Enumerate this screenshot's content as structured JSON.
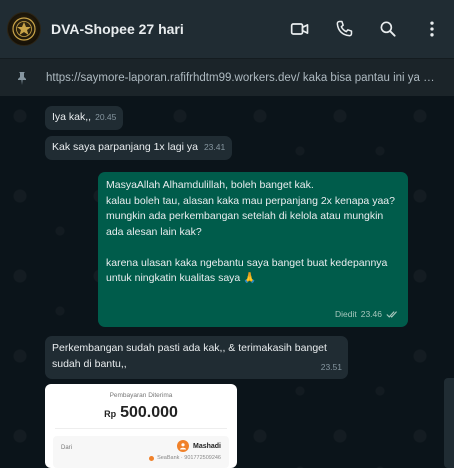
{
  "header": {
    "title": "DVA-Shopee 27 hari",
    "avatar_icon": "gold-emblem-icon",
    "actions": [
      "video-call-icon",
      "voice-call-icon",
      "search-icon",
      "more-options-icon"
    ]
  },
  "pinned": {
    "icon": "pin-icon",
    "text": "https://saymore-laporan.rafifrhdtm99.workers.dev/ kaka bisa pantau ini ya u..."
  },
  "messages": [
    {
      "direction": "incoming",
      "text": "Iya kak,,",
      "time": "20.45"
    },
    {
      "direction": "incoming",
      "text": "Kak saya parpanjang 1x lagi ya",
      "time": "23.41"
    },
    {
      "direction": "outgoing",
      "text": "MasyaAllah Alhamdulillah, boleh banget kak.\nkalau boleh tau, alasan kaka mau perpanjang 2x kenapa yaa?\nmungkin ada perkembangan setelah di kelola atau mungkin ada alesan lain kak?\n\nkarena ulasan kaka ngebantu saya banget buat kedepannya untuk ningkatin kualitas saya 🙏",
      "edited_label": "Diedit",
      "time": "23.46",
      "status": "read"
    },
    {
      "direction": "incoming",
      "text": "Perkembangan sudah pasti ada kak,, & terimakasih banget sudah di bantu,,",
      "time": "23.51"
    }
  ],
  "receipt": {
    "caption": "Pembayaran Diterima",
    "currency": "Rp",
    "amount": "500.000",
    "from_label": "Dari",
    "sender_name": "Mashadi",
    "bank_info": "SeaBank · 901772509246",
    "accent_color": "#f0812a"
  },
  "colors": {
    "header_bg": "#202c33",
    "chat_bg": "#0b141a",
    "incoming_bubble": "#202c33",
    "outgoing_bubble": "#005c4b"
  }
}
